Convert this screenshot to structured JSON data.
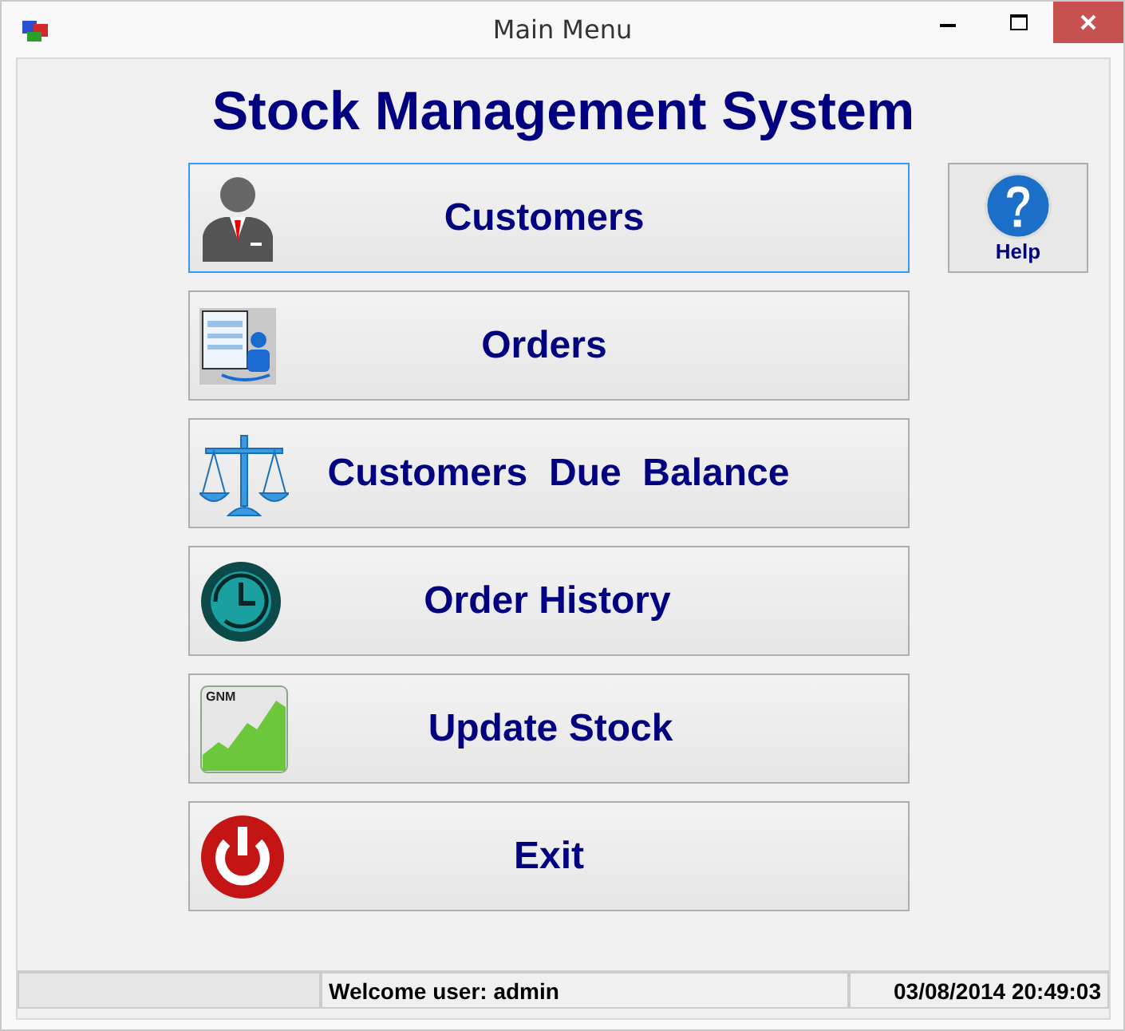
{
  "window": {
    "title": "Main Menu"
  },
  "heading": "Stock Management System",
  "menu_buttons": [
    {
      "label": "Customers",
      "kind": "person",
      "focused": true
    },
    {
      "label": "Orders",
      "kind": "document",
      "focused": false
    },
    {
      "label": "Customers  Due  Balance",
      "kind": "scale",
      "focused": false
    },
    {
      "label": "Order History",
      "kind": "history",
      "focused": false
    },
    {
      "label": "Update Stock",
      "kind": "chart",
      "icon_text": "GNM",
      "focused": false
    },
    {
      "label": "Exit",
      "kind": "power",
      "focused": false
    }
  ],
  "help_button": {
    "label": "Help"
  },
  "status_bar": {
    "welcome": "Welcome user: admin",
    "datetime": "03/08/2014 20:49:03"
  }
}
